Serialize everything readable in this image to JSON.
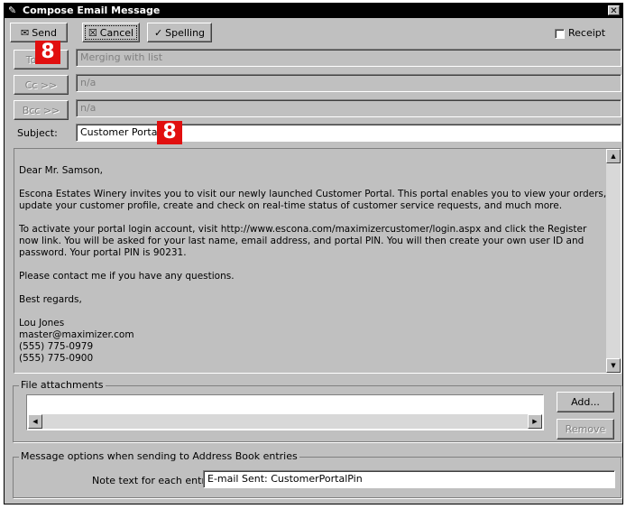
{
  "window": {
    "title": "Compose Email Message",
    "close_glyph": "✕"
  },
  "toolbar": {
    "send_label": "Send",
    "cancel_label": "Cancel",
    "spelling_label": "Spelling",
    "receipt_label": "Receipt"
  },
  "recipients": {
    "to_label": "To >>",
    "to_value": "Merging with list",
    "cc_label": "Cc >>",
    "cc_value": "n/a",
    "bcc_label": "Bcc >>",
    "bcc_value": "n/a"
  },
  "subject": {
    "label": "Subject:",
    "value": "Customer Portal"
  },
  "badges": {
    "send_badge": "8",
    "subject_badge": "8",
    "color": "#e10f0f"
  },
  "message": {
    "greeting": "Dear Mr. Samson,",
    "para1": "Escona Estates Winery invites you to visit our newly launched Customer Portal. This portal enables you to view your orders, update your customer profile, create and check on real-time status of customer service requests, and much more.",
    "para2": "To activate your portal login account, visit http://www.escona.com/maximizercustomer/login.aspx and click the Register now link. You will be asked for your last name, email address, and portal PIN. You will then create your own user ID and password. Your portal PIN is 90231.",
    "para3": "Please contact me if you have any questions.",
    "closing": "Best regards,",
    "sig_name": "Lou Jones",
    "sig_email": "master@maximizer.com",
    "sig_phone1": "(555) 775-0979",
    "sig_phone2": "(555) 775-0900"
  },
  "attachments": {
    "legend": "File attachments",
    "add_label": "Add...",
    "remove_label": "Remove"
  },
  "options": {
    "legend": "Message options when sending to Address Book entries",
    "note_label": "Note text for each entry:",
    "note_value": "E-mail Sent: CustomerPortalPin"
  }
}
